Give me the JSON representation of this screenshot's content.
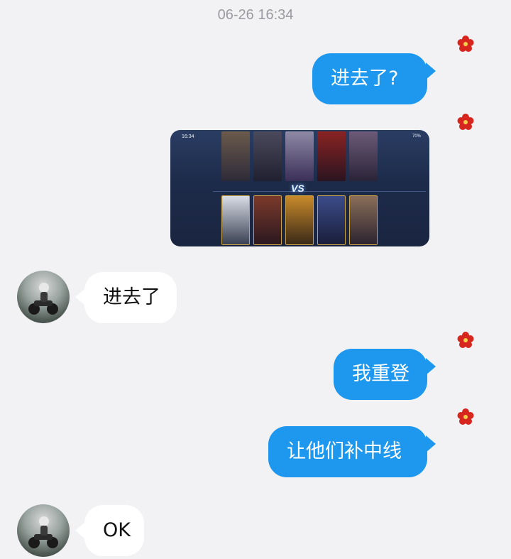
{
  "timestamp": "06-26 16:34",
  "messages": [
    {
      "side": "out",
      "text": "进去了?"
    },
    {
      "side": "out",
      "type": "image"
    },
    {
      "side": "in",
      "text": "进去了"
    },
    {
      "side": "out",
      "text": "我重登"
    },
    {
      "side": "out",
      "text": "让他们补中线"
    },
    {
      "side": "in",
      "text": "OK"
    }
  ],
  "screenshot": {
    "status_time": "16:34",
    "status_right": "70%",
    "vs_label": "VS"
  },
  "colors": {
    "outgoing_bubble": "#1e98ef",
    "incoming_bubble": "#ffffff",
    "background": "#f2f2f4",
    "flower": "#d7261e"
  },
  "icons": {
    "sender_avatar_decoration": "red-flower-icon",
    "contact_avatar": "avatar"
  }
}
